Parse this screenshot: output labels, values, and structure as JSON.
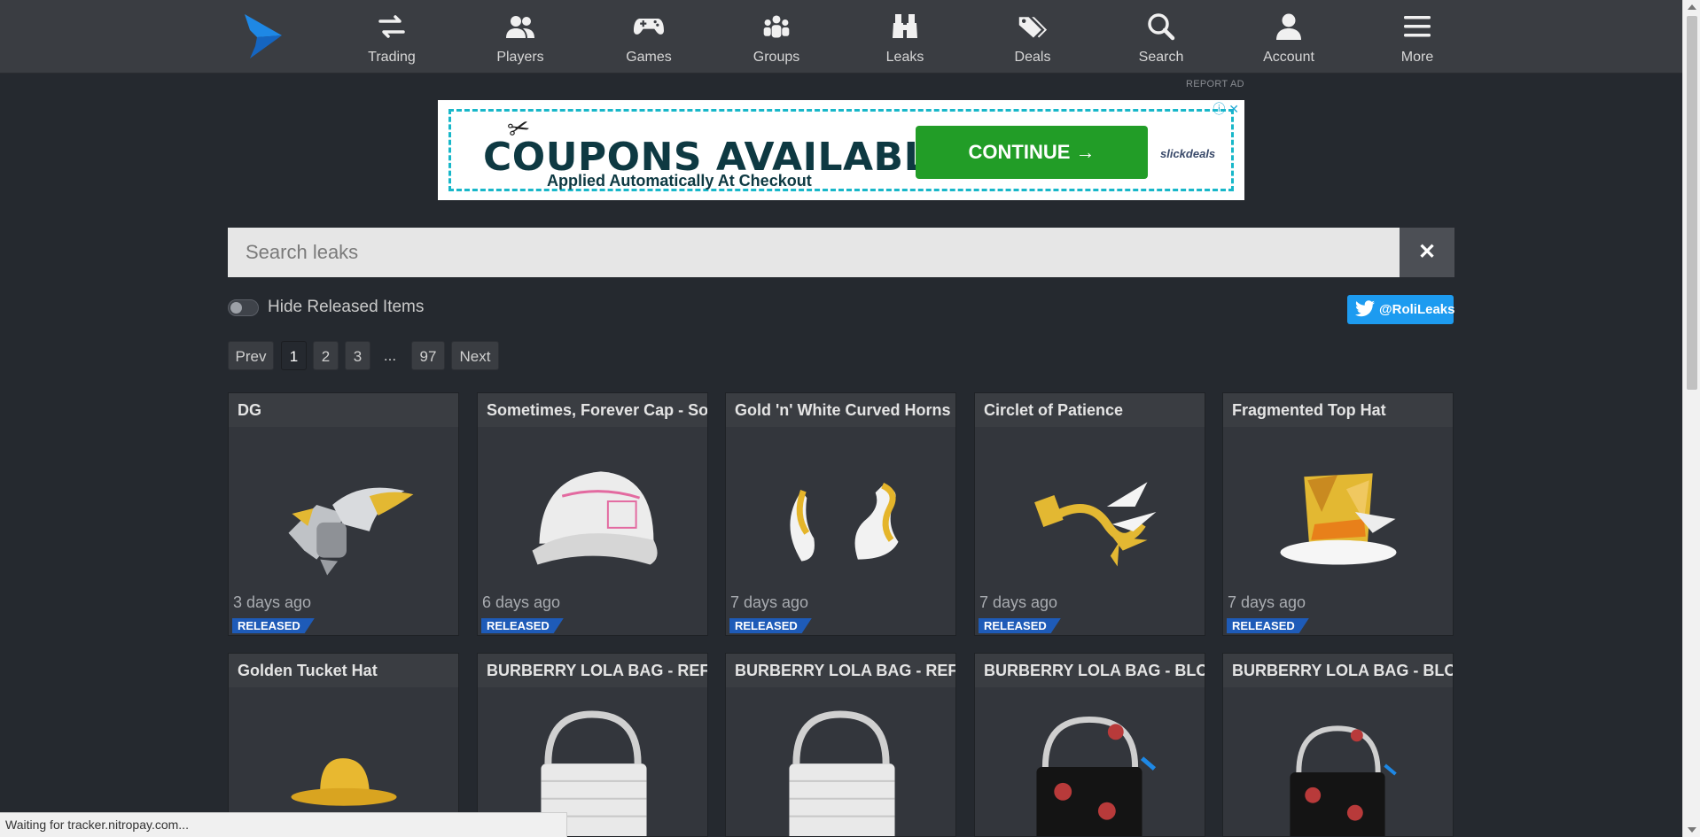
{
  "nav": {
    "items": [
      {
        "label": "Trading",
        "icon": "arrows-exchange-icon"
      },
      {
        "label": "Players",
        "icon": "users-icon"
      },
      {
        "label": "Games",
        "icon": "gamepad-icon"
      },
      {
        "label": "Groups",
        "icon": "group-icon"
      },
      {
        "label": "Leaks",
        "icon": "binoculars-icon"
      },
      {
        "label": "Deals",
        "icon": "tags-icon"
      },
      {
        "label": "Search",
        "icon": "search-icon"
      },
      {
        "label": "Account",
        "icon": "user-icon"
      },
      {
        "label": "More",
        "icon": "menu-icon"
      }
    ]
  },
  "ad": {
    "report_label": "REPORT AD",
    "headline": "COUPONS AVAILABLE",
    "subline": "Applied Automatically At Checkout",
    "button_label": "CONTINUE →",
    "brand": "slickdeals"
  },
  "search": {
    "placeholder": "Search leaks",
    "value": "",
    "clear": "✕"
  },
  "filter": {
    "hide_released_label": "Hide Released Items",
    "hide_released": false
  },
  "twitter": {
    "label": "@RoliLeaks"
  },
  "pagination": {
    "prev": "Prev",
    "pages": [
      "1",
      "2",
      "3"
    ],
    "ellipsis": "...",
    "last": "97",
    "next": "Next",
    "current": "1"
  },
  "items": [
    {
      "name": "DG",
      "date": "3 days ago",
      "badge": "RELEASED"
    },
    {
      "name": "Sometimes, Forever Cap - So...",
      "date": "6 days ago",
      "badge": "RELEASED"
    },
    {
      "name": "Gold 'n' White Curved Horns",
      "date": "7 days ago",
      "badge": "RELEASED"
    },
    {
      "name": "Circlet of Patience",
      "date": "7 days ago",
      "badge": "RELEASED"
    },
    {
      "name": "Fragmented Top Hat",
      "date": "7 days ago",
      "badge": "RELEASED"
    },
    {
      "name": "Golden Tucket Hat"
    },
    {
      "name": "BURBERRY LOLA BAG - REFL..."
    },
    {
      "name": "BURBERRY LOLA BAG - REFL..."
    },
    {
      "name": "BURBERRY LOLA BAG - BLO..."
    },
    {
      "name": "BURBERRY LOLA BAG - BLO..."
    }
  ],
  "status_bar": {
    "text": "Waiting for tracker.nitropay.com..."
  },
  "colors": {
    "accent": "#1e5bb8",
    "twitter": "#1d9bf0",
    "background": "#25292f",
    "topbar": "#3a3d42"
  }
}
